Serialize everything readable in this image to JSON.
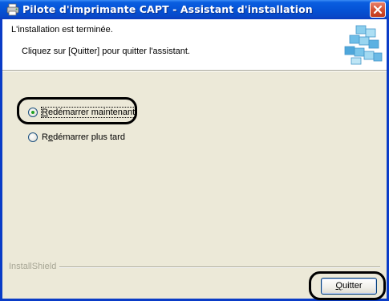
{
  "window": {
    "title": "Pilote d'imprimante CAPT - Assistant d'installation"
  },
  "header": {
    "line1": "L'installation est terminée.",
    "line2": "Cliquez sur [Quitter] pour quitter l'assistant."
  },
  "options": [
    {
      "pre": "",
      "accel": "R",
      "post": "edémarrer maintenant",
      "checked": true
    },
    {
      "pre": "R",
      "accel": "e",
      "post": "démarrer plus tard",
      "checked": false
    }
  ],
  "footer": {
    "brand": "InstallShield",
    "quit_pre": "",
    "quit_accel": "Q",
    "quit_post": "uitter"
  },
  "colors": {
    "titlebar": "#0553d6",
    "dialog_bg": "#ece9d8",
    "close": "#d24f30"
  }
}
